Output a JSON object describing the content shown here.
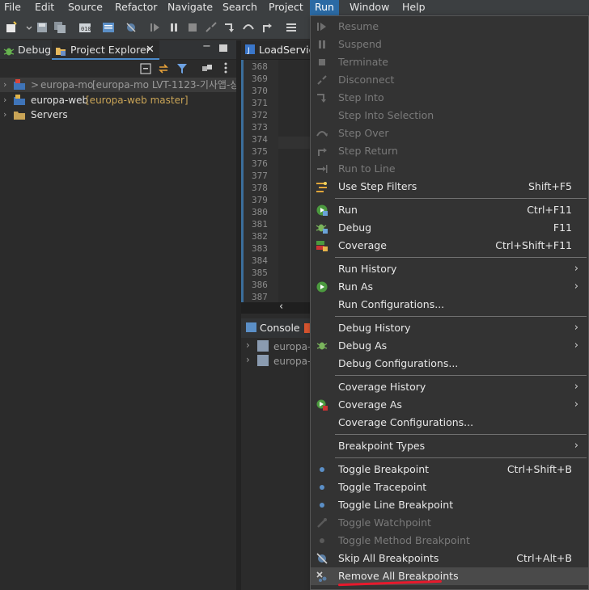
{
  "menubar": {
    "items": [
      "File",
      "Edit",
      "Source",
      "Refactor",
      "Navigate",
      "Search",
      "Project",
      "Run",
      "Window",
      "Help"
    ],
    "active": "Run"
  },
  "left_panel": {
    "tabs": [
      {
        "label": "Debug",
        "icon": "bug-icon"
      },
      {
        "label": "Project Explorer",
        "icon": "project-explorer-icon"
      }
    ],
    "tree": [
      {
        "prefix": ">",
        "name": "europa-mo",
        "detail": "[europa-mo LVT-1123-기사앱-상",
        "icon": "project-icon"
      },
      {
        "prefix": "",
        "name": "europa-web",
        "detail": "[europa-web master]",
        "icon": "project-icon"
      },
      {
        "prefix": "",
        "name": "Servers",
        "detail": "",
        "icon": "folder-icon"
      }
    ]
  },
  "editor": {
    "tab_label": "LoadService",
    "line_numbers": [
      "368",
      "369",
      "370",
      "371",
      "372",
      "373",
      "374",
      "375",
      "376",
      "377",
      "378",
      "379",
      "380",
      "381",
      "382",
      "383",
      "384",
      "385",
      "386",
      "387"
    ]
  },
  "console": {
    "tab_label": "Console",
    "items": [
      "europa-m",
      "europa-w"
    ]
  },
  "run_menu": {
    "items": [
      {
        "label": "Resume",
        "shortcut": "",
        "disabled": true,
        "icon": "resume-icon"
      },
      {
        "label": "Suspend",
        "shortcut": "",
        "disabled": true,
        "icon": "suspend-icon"
      },
      {
        "label": "Terminate",
        "shortcut": "",
        "disabled": true,
        "icon": "terminate-icon"
      },
      {
        "label": "Disconnect",
        "shortcut": "",
        "disabled": true,
        "icon": "disconnect-icon"
      },
      {
        "label": "Step Into",
        "shortcut": "",
        "disabled": true,
        "icon": "step-into-icon"
      },
      {
        "label": "Step Into Selection",
        "shortcut": "",
        "disabled": true,
        "icon": ""
      },
      {
        "label": "Step Over",
        "shortcut": "",
        "disabled": true,
        "icon": "step-over-icon"
      },
      {
        "label": "Step Return",
        "shortcut": "",
        "disabled": true,
        "icon": "step-return-icon"
      },
      {
        "label": "Run to Line",
        "shortcut": "",
        "disabled": true,
        "icon": "run-to-line-icon"
      },
      {
        "label": "Use Step Filters",
        "shortcut": "Shift+F5",
        "disabled": false,
        "icon": "step-filters-icon"
      },
      {
        "sep": true
      },
      {
        "label": "Run",
        "shortcut": "Ctrl+F11",
        "disabled": false,
        "icon": "run-icon"
      },
      {
        "label": "Debug",
        "shortcut": "F11",
        "disabled": false,
        "icon": "debug-icon"
      },
      {
        "label": "Coverage",
        "shortcut": "Ctrl+Shift+F11",
        "disabled": false,
        "icon": "coverage-icon"
      },
      {
        "sep": true
      },
      {
        "label": "Run History",
        "submenu": true,
        "disabled": false,
        "icon": ""
      },
      {
        "label": "Run As",
        "submenu": true,
        "disabled": false,
        "icon": "run-as-icon"
      },
      {
        "label": "Run Configurations...",
        "disabled": false,
        "icon": ""
      },
      {
        "sep": true
      },
      {
        "label": "Debug History",
        "submenu": true,
        "disabled": false,
        "icon": ""
      },
      {
        "label": "Debug As",
        "submenu": true,
        "disabled": false,
        "icon": "debug-as-icon"
      },
      {
        "label": "Debug Configurations...",
        "disabled": false,
        "icon": ""
      },
      {
        "sep": true
      },
      {
        "label": "Coverage History",
        "submenu": true,
        "disabled": false,
        "icon": ""
      },
      {
        "label": "Coverage As",
        "submenu": true,
        "disabled": false,
        "icon": "coverage-as-icon"
      },
      {
        "label": "Coverage Configurations...",
        "disabled": false,
        "icon": ""
      },
      {
        "sep": true
      },
      {
        "label": "Breakpoint Types",
        "submenu": true,
        "disabled": false,
        "icon": ""
      },
      {
        "sep": true
      },
      {
        "label": "Toggle Breakpoint",
        "shortcut": "Ctrl+Shift+B",
        "disabled": false,
        "icon": "breakpoint-dot-icon"
      },
      {
        "label": "Toggle Tracepoint",
        "shortcut": "",
        "disabled": false,
        "icon": "breakpoint-dot-icon"
      },
      {
        "label": "Toggle Line Breakpoint",
        "shortcut": "",
        "disabled": false,
        "icon": "breakpoint-dot-icon"
      },
      {
        "label": "Toggle Watchpoint",
        "shortcut": "",
        "disabled": true,
        "icon": "watchpoint-icon"
      },
      {
        "label": "Toggle Method Breakpoint",
        "shortcut": "",
        "disabled": true,
        "icon": "breakpoint-dot-icon"
      },
      {
        "label": "Skip All Breakpoints",
        "shortcut": "Ctrl+Alt+B",
        "disabled": false,
        "icon": "skip-breakpoints-icon"
      },
      {
        "label": "Remove All Breakpoints",
        "shortcut": "",
        "disabled": false,
        "icon": "remove-breakpoints-icon",
        "highlighted": true
      }
    ]
  },
  "colors": {
    "accent": "#2b6aa4",
    "annotation": "#e8192c"
  }
}
